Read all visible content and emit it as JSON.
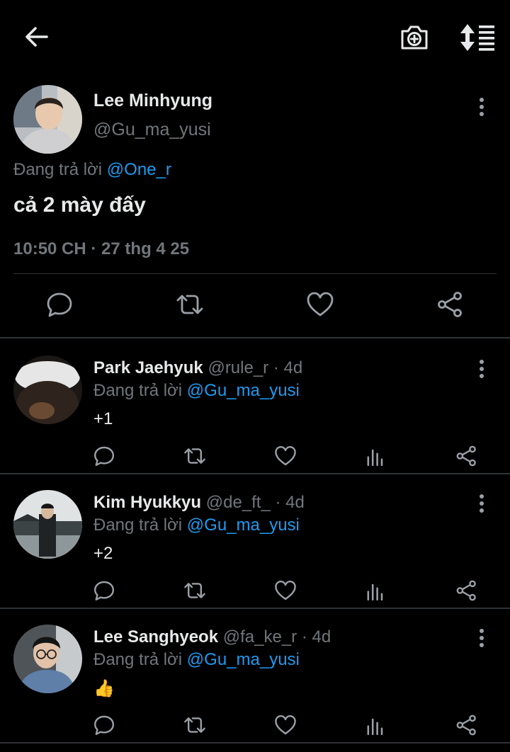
{
  "icons": {
    "back": "arrow-left-icon",
    "camera": "camera-add-icon",
    "sort": "sort-list-icon",
    "more": "more-vertical-icon",
    "reply": "reply-icon",
    "retweet": "retweet-icon",
    "like": "heart-icon",
    "views": "views-chart-icon",
    "share": "share-icon"
  },
  "colors": {
    "background": "#000000",
    "text": "#e7e9ea",
    "secondary": "#71767b",
    "mention": "#1d9bf0",
    "divider": "#2f3336"
  },
  "main_tweet": {
    "name": "Lee Minhyung",
    "handle": "@Gu_ma_yusi",
    "replying_label": "Đang trả lời",
    "replying_to": "@One_r",
    "text": "cả 2 mày đấy",
    "time": "10:50 CH",
    "date": "27 thg 4 25",
    "meta_sep": " · "
  },
  "replies": [
    {
      "name": "Park Jaehyuk",
      "handle": "@rule_r",
      "age": "4d",
      "replying_label": "Đang trả lời",
      "replying_to": "@Gu_ma_yusi",
      "text": "+1"
    },
    {
      "name": "Kim Hyukkyu",
      "handle": "@de_ft_",
      "age": "4d",
      "replying_label": "Đang trả lời",
      "replying_to": "@Gu_ma_yusi",
      "text": "+2"
    },
    {
      "name": "Lee Sanghyeok",
      "handle": "@fa_ke_r",
      "age": "4d",
      "replying_label": "Đang trả lời",
      "replying_to": "@Gu_ma_yusi",
      "text": "👍"
    }
  ],
  "separators": {
    "dot": " · "
  }
}
